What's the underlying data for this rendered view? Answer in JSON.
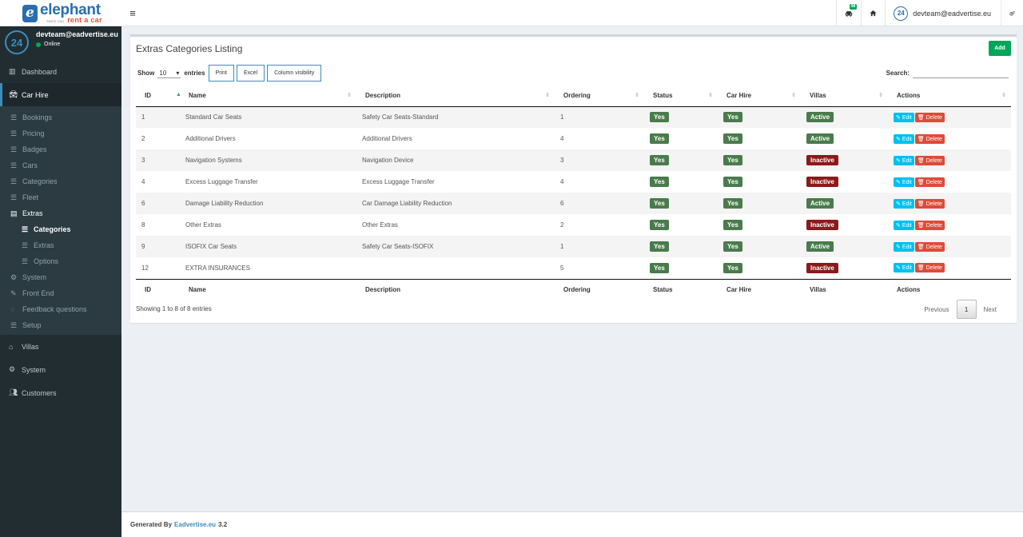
{
  "brand": {
    "name": "elephant",
    "since": "SINCE 1981",
    "tagline": "rent a car",
    "avatar_text": "24"
  },
  "topbar": {
    "badge": "98",
    "user_email": "devteam@eadvertise.eu"
  },
  "sidebar": {
    "user_name": "devteam@eadvertise.eu",
    "status": "Online",
    "dashboard": "Dashboard",
    "car_hire": "Car Hire",
    "car_hire_items": [
      "Bookings",
      "Pricing",
      "Badges",
      "Cars",
      "Categories",
      "Fleet"
    ],
    "extras": "Extras",
    "extras_items": [
      "Categories",
      "Extras",
      "Options"
    ],
    "after_items": [
      "System",
      "Front End",
      "Feedback questions",
      "Setup"
    ],
    "villas": "Villas",
    "system": "System",
    "customers": "Customers"
  },
  "page": {
    "title": "Extras Categories Listing",
    "add_label": "Add",
    "show_label": "Show",
    "entries_value": "10",
    "entries_label": "entries",
    "buttons": [
      "Print",
      "Excel",
      "Column visibility"
    ],
    "search_label": "Search:",
    "columns": [
      "ID",
      "Name",
      "Description",
      "Ordering",
      "Status",
      "Car Hire",
      "Villas",
      "Actions"
    ],
    "rows": [
      {
        "id": "1",
        "name": "Standard Car Seats",
        "description": "Safety Car Seats-Standard",
        "ordering": "1",
        "status": "Yes",
        "car_hire": "Yes",
        "villas": "Active"
      },
      {
        "id": "2",
        "name": "Additional Drivers",
        "description": "Additional Drivers",
        "ordering": "4",
        "status": "Yes",
        "car_hire": "Yes",
        "villas": "Active"
      },
      {
        "id": "3",
        "name": "Navigation Systems",
        "description": "Navigation Device",
        "ordering": "3",
        "status": "Yes",
        "car_hire": "Yes",
        "villas": "Inactive"
      },
      {
        "id": "4",
        "name": "Excess Luggage Transfer",
        "description": "Excess Luggage Transfer",
        "ordering": "4",
        "status": "Yes",
        "car_hire": "Yes",
        "villas": "Inactive"
      },
      {
        "id": "6",
        "name": "Damage Liability Reduction",
        "description": "Car Damage Liability Reduction",
        "ordering": "6",
        "status": "Yes",
        "car_hire": "Yes",
        "villas": "Active"
      },
      {
        "id": "8",
        "name": "Other Extras",
        "description": "Other Extras",
        "ordering": "2",
        "status": "Yes",
        "car_hire": "Yes",
        "villas": "Inactive"
      },
      {
        "id": "9",
        "name": "ISOFIX Car Seats",
        "description": "Safety Car Seats-ISOFIX",
        "ordering": "1",
        "status": "Yes",
        "car_hire": "Yes",
        "villas": "Active"
      },
      {
        "id": "12",
        "name": "EXTRA INSURANCES",
        "description": "",
        "ordering": "5",
        "status": "Yes",
        "car_hire": "Yes",
        "villas": "Inactive"
      }
    ],
    "edit_label": "Edit",
    "delete_label": "Delete",
    "info": "Showing 1 to 8 of 8 entries",
    "pager": {
      "previous": "Previous",
      "current": "1",
      "next": "Next"
    }
  },
  "footer": {
    "prefix": "Generated By",
    "link": "Eadvertise.eu",
    "version": "3.2"
  },
  "colors": {
    "sidebar_bg": "#222d32",
    "accent": "#3c8dbc",
    "green": "#00a65a",
    "yes_label": "#4a7b4c",
    "inactive_label": "#8b1a1a"
  }
}
